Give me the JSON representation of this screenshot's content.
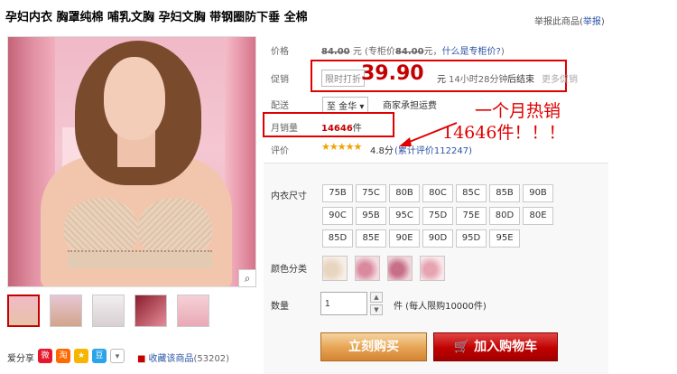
{
  "title": "孕妇内衣 胸罩纯棉 哺乳文胸 孕妇文胸 带钢圈防下垂 全棉",
  "report": {
    "prefix": "举报此商品(",
    "link": "举报",
    "suffix": ")"
  },
  "price": {
    "label": "价格",
    "original": "84.00",
    "unit": "元",
    "counter_prefix": "(专柜价",
    "counter_value": "84.00",
    "counter_suffix": "元，",
    "counter_link": "什么是专柜价?",
    "counter_close": ")"
  },
  "promo": {
    "label": "促销",
    "badge": "限时打折",
    "price": "39.90",
    "unit": "元",
    "timer": "14小时28分钟",
    "end_text": "后结束",
    "more": "更多促销"
  },
  "shipping": {
    "label": "配送",
    "select_value": "至 金华",
    "select_arrow": "▾",
    "text": "商家承担运费"
  },
  "sales": {
    "label": "月销量",
    "value": "14646",
    "unit": "件"
  },
  "rating": {
    "label": "评价",
    "stars": "★★★★★",
    "score": "4.8分",
    "link": "(累计评价112247)"
  },
  "annotation": {
    "line1": "一个月热销",
    "line2": "14646件！！！"
  },
  "sizes": {
    "label": "内衣尺寸",
    "row1": [
      "75B",
      "75C",
      "80B",
      "80C",
      "85C",
      "85B",
      "90B"
    ],
    "row2": [
      "90C",
      "95B",
      "95C",
      "75D",
      "75E",
      "80D",
      "80E"
    ],
    "row3": [
      "85D",
      "85E",
      "90E",
      "90D",
      "95D",
      "95E"
    ]
  },
  "colors": {
    "label": "颜色分类"
  },
  "quantity": {
    "label": "数量",
    "value": "1",
    "unit_text": "件 (每人限购10000件)"
  },
  "buttons": {
    "buy": "立刻购买",
    "cart": "加入购物车",
    "cart_icon": "🛒"
  },
  "gallery": {
    "zoom_icon": "⌕"
  },
  "share": {
    "label": "爱分享",
    "icons": [
      "weibo-icon",
      "taobao-icon",
      "qzone-icon",
      "douban-icon",
      "more-icon"
    ],
    "fav_label": "收藏该商品",
    "fav_count": "(53202)"
  },
  "colors_palette": {
    "accent": "#c40000",
    "link": "#2953a6",
    "buy": "#e8a658",
    "cart": "#c00000"
  }
}
